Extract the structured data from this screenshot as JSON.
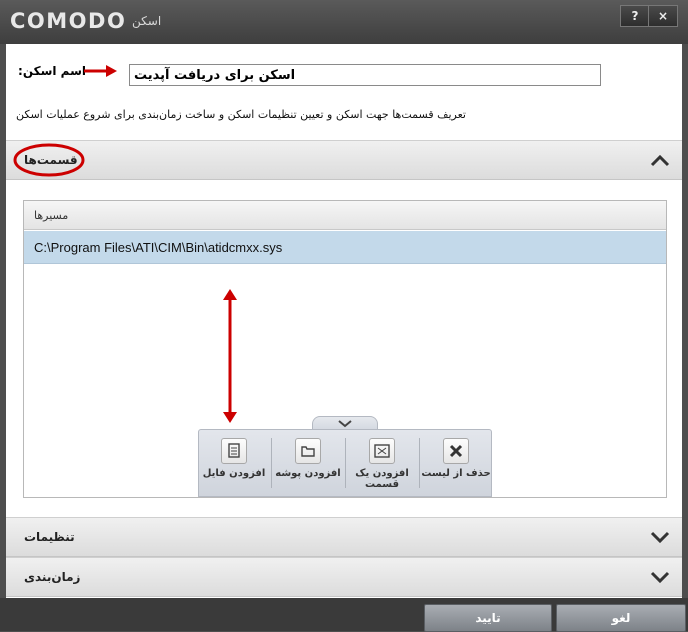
{
  "window": {
    "brand": "COMODO",
    "title": "اسکن",
    "help_label": "?",
    "close_label": "×"
  },
  "form": {
    "name_label": ":اسم اسکن",
    "name_value": "اسکن برای دریافت آپدیت",
    "description": "تعریف قسمت‌ها جهت اسکن و تعیین تنظیمات اسکن و ساخت زمان‌بندی برای شروع عملیات اسکن"
  },
  "sections": {
    "parts": "قسمت‌ها",
    "settings": "تنظیمات",
    "schedule": "زمان‌بندی"
  },
  "paths_table": {
    "header": "مسیرها",
    "rows": [
      "C:\\Program Files\\ATI\\CIM\\Bin\\atidcmxx.sys"
    ]
  },
  "toolbar": {
    "add_file": "افزودن فایل",
    "add_folder": "افزودن پوشه",
    "add_region": "افزودن یک قسمت",
    "remove": "حذف از لیست"
  },
  "footer": {
    "ok": "تایید",
    "cancel": "لغو"
  },
  "colors": {
    "annotation": "#cc0000",
    "selection": "#c3d9ea"
  },
  "icons": [
    "file-icon",
    "folder-icon",
    "region-icon",
    "remove-icon",
    "chevron-up-icon",
    "chevron-down-icon"
  ]
}
